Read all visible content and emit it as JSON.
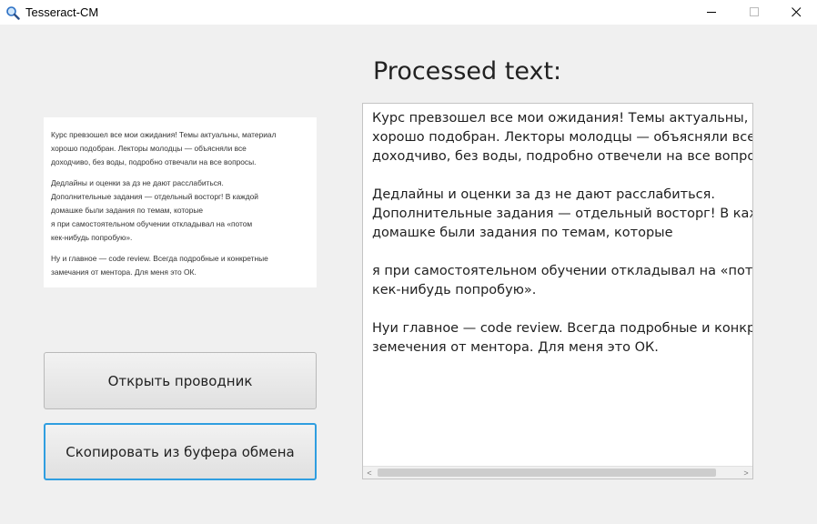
{
  "window": {
    "title": "Tesseract-CM",
    "icon": "magnifier-icon",
    "minimize_glyph": "—",
    "maximize_glyph": "☐",
    "close_glyph": "✕"
  },
  "preview": {
    "paragraphs": [
      "Курс превзошел все мои ожидания! Темы актуальны, материал\nхорошо подобран. Лекторы молодцы — объясняли все\nдоходчиво, без воды, подробно отвечали на все вопросы.",
      "Дедлайны и оценки за дз не дают расслабиться.\nДополнительные задания — отдельный восторг! В каждой\nдомашке были задания по темам, которые\nя при самостоятельном обучении откладывал на «потом\nкек-нибудь попробую».",
      "Ну и главное — code review. Всегда подробные и конкретные\nзамечания от ментора. Для меня это ОК."
    ]
  },
  "buttons": {
    "open_explorer": "Открыть проводник",
    "paste_clipboard": "Скопировать из буфера обмена"
  },
  "output": {
    "heading": "Processed text:",
    "paragraphs": [
      "Курс превзошел все мои ожидания! Темы актуальны, материал\nхорошо подобран. Лекторы молодцы — объясняли все\nдоходчиво, без воды, подробно отвечели на все вопросы.",
      "Дедлайны и оценки за дз не дают расслабиться.\nДополнительные задания — отдельный восторг! В каждой\nдомашке были задания по темам, которые",
      "я при самостоятельном обучении откладывал на «потом\nкек-нибудь попробую».",
      "Нуи главное — code review. Всегда подробные и конкретные\nземечения от ментора. Для меня это ОК."
    ],
    "scroll_left_glyph": "<",
    "scroll_right_glyph": ">"
  }
}
